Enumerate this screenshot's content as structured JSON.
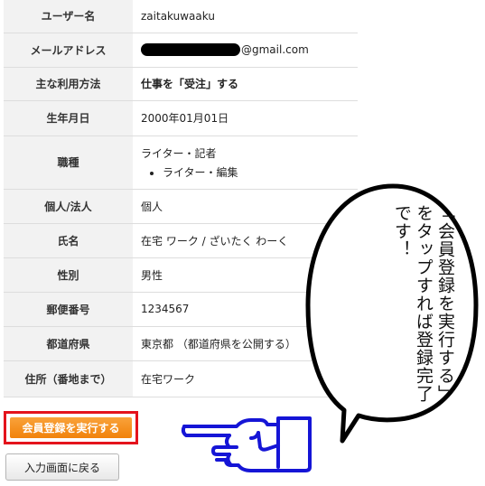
{
  "rows": [
    {
      "label": "ユーザー名",
      "value": "zaitakuwaaku"
    },
    {
      "label": "メールアドレス",
      "value": "@gmail.com"
    },
    {
      "label": "主な利用方法",
      "value": "仕事を「受注」する"
    },
    {
      "label": "生年月日",
      "value": "2000年01月01日"
    },
    {
      "label": "職種",
      "value": "ライター・記者",
      "sub": "ライター・編集"
    },
    {
      "label": "個人/法人",
      "value": "個人"
    },
    {
      "label": "氏名",
      "value": "在宅 ワーク / ざいたく わーく"
    },
    {
      "label": "性別",
      "value": "男性"
    },
    {
      "label": "郵便番号",
      "value": "1234567"
    },
    {
      "label": "都道府県",
      "value": "東京都 （都道府県を公開する）"
    },
    {
      "label": "住所（番地まで）",
      "value": "在宅ワーク"
    }
  ],
  "buttons": {
    "register": "会員登録を実行する",
    "back": "入力画面に戻る"
  },
  "bubble": {
    "text": "「会員登録を実行する」をタップすれば登録完了です！"
  },
  "colors": {
    "register_button": "#f1820b",
    "register_highlight": "#e4131c",
    "hand": "#1515d6"
  }
}
